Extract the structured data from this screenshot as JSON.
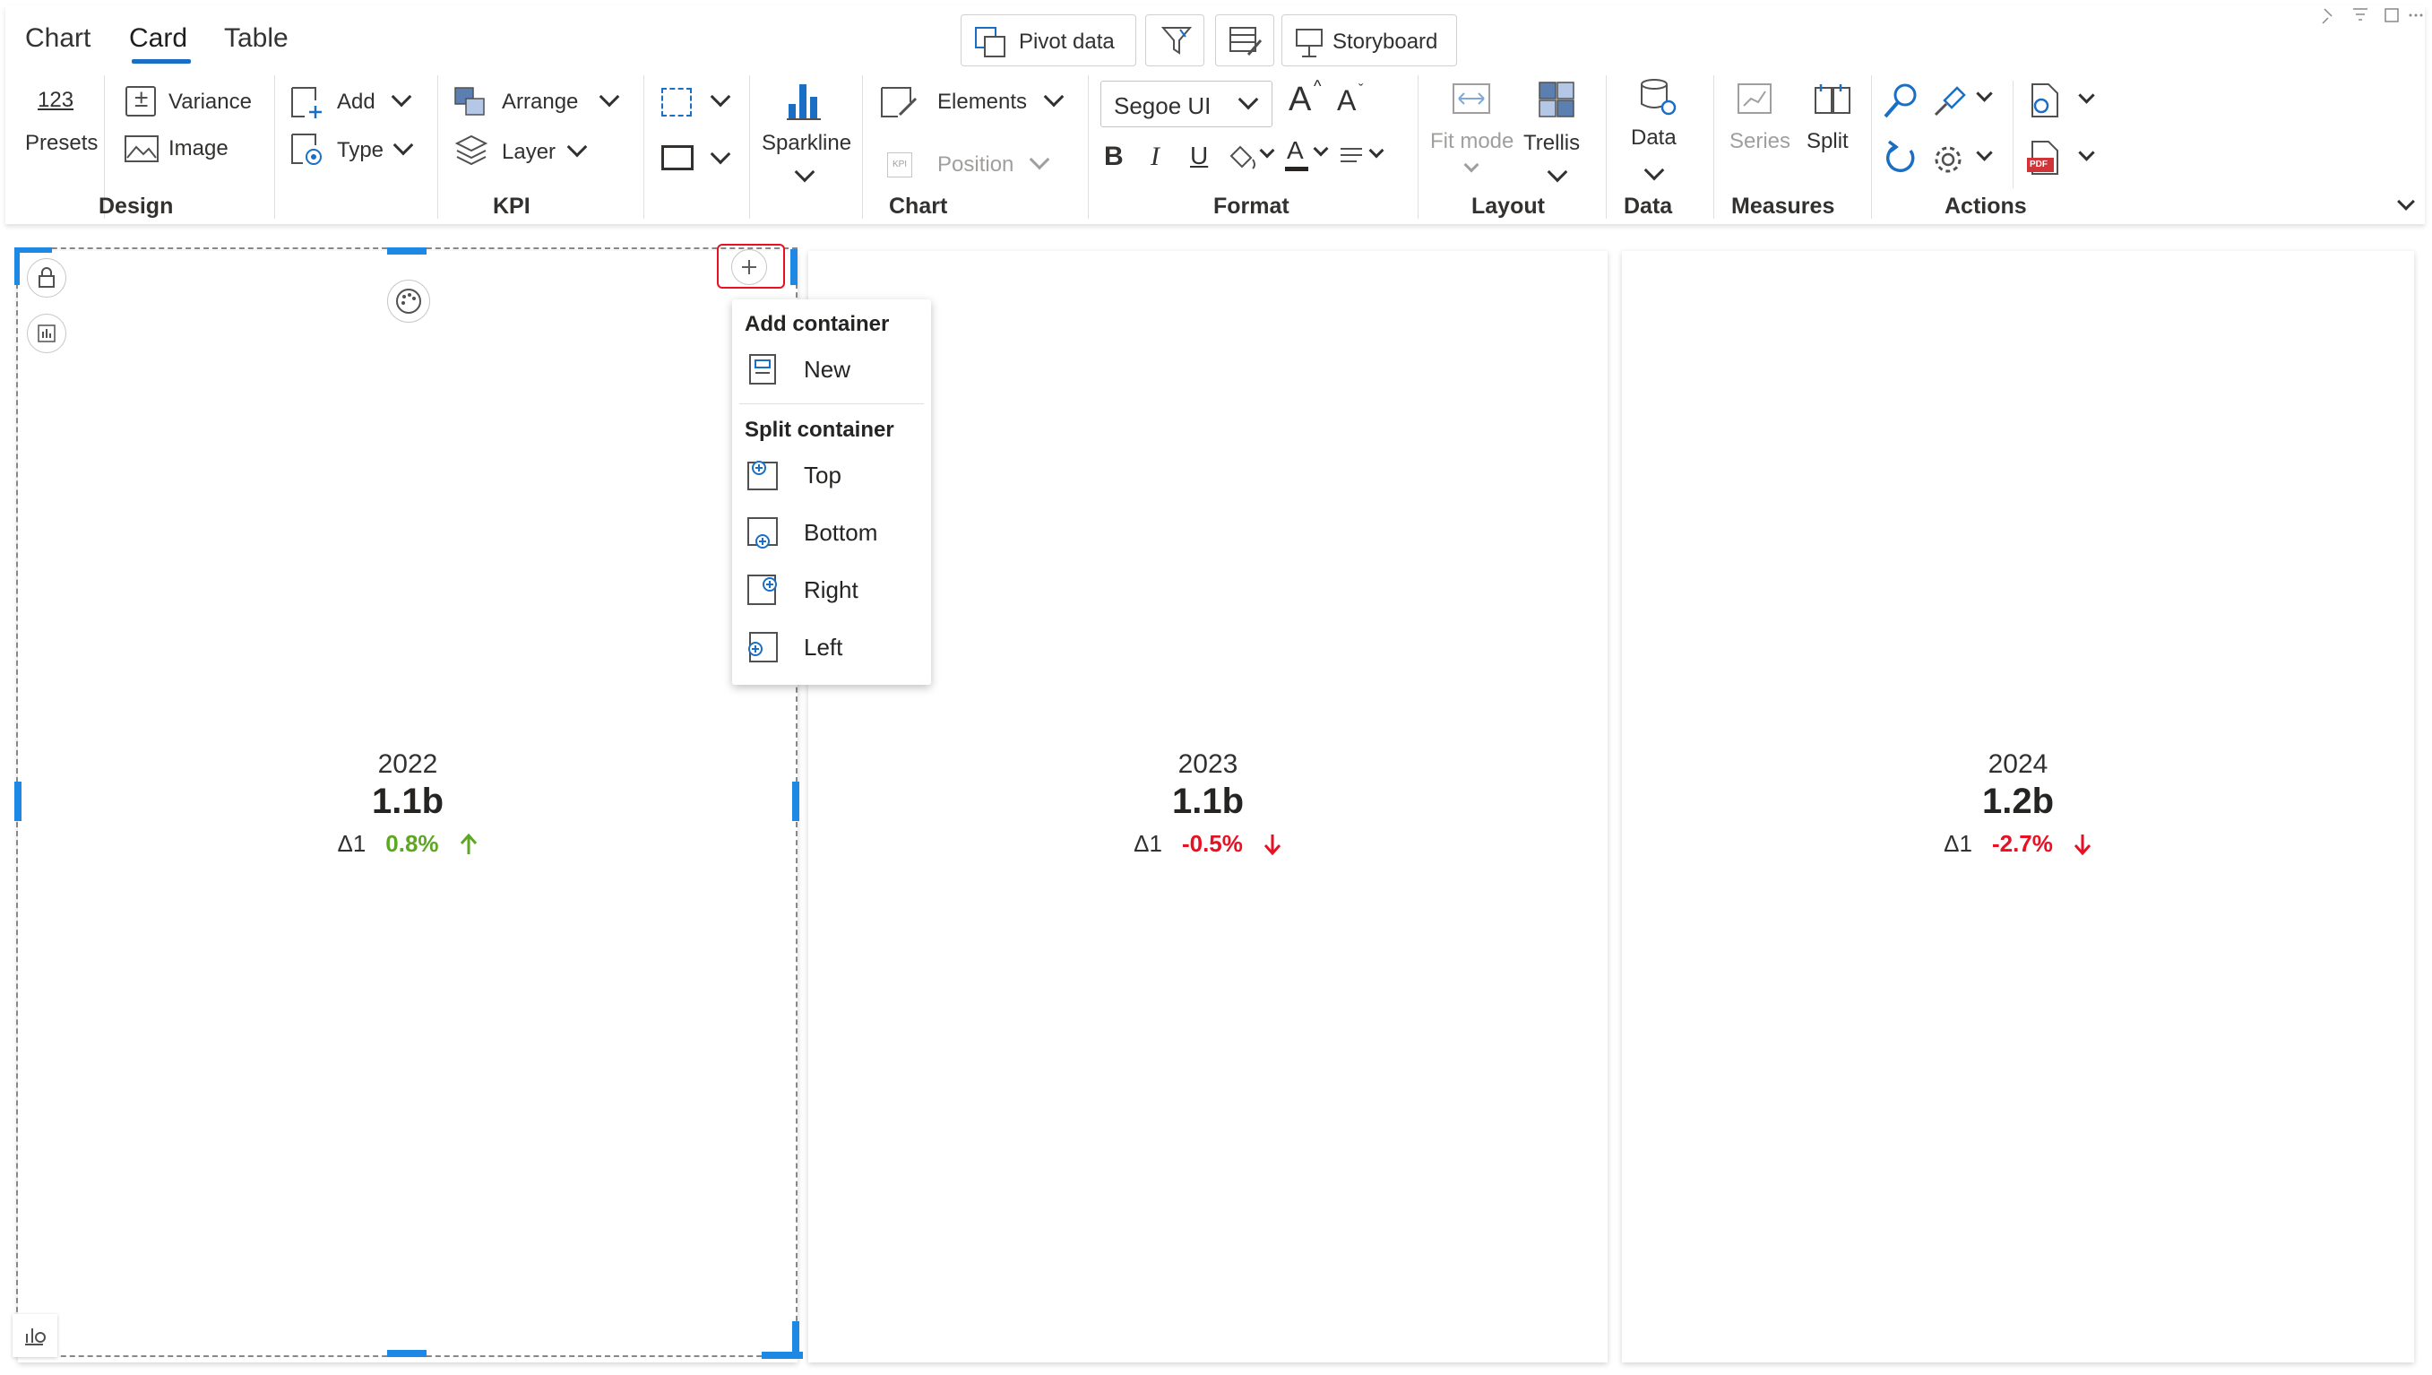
{
  "tabs": [
    {
      "label": "Chart",
      "active": false
    },
    {
      "label": "Card",
      "active": true
    },
    {
      "label": "Table",
      "active": false
    }
  ],
  "top_buttons": {
    "pivot": "Pivot data",
    "storyboard": "Storyboard"
  },
  "design": {
    "presets_number": "123",
    "presets": "Presets",
    "variance": "Variance",
    "image": "Image",
    "title": "Design"
  },
  "kpi": {
    "add": "Add",
    "type": "Type",
    "arrange": "Arrange",
    "layer": "Layer",
    "sparkline": "Sparkline",
    "title": "KPI"
  },
  "chart_group": {
    "elements": "Elements",
    "position": "Position",
    "kpi_badge": "KPI",
    "title": "Chart"
  },
  "format": {
    "font": "Segoe UI",
    "bold": "B",
    "italic": "I",
    "underline": "U",
    "color_letter": "A",
    "grow": "A",
    "shrink": "A",
    "title": "Format"
  },
  "layout": {
    "fit_mode": "Fit mode",
    "trellis": "Trellis",
    "title": "Layout"
  },
  "data_group": {
    "data": "Data",
    "title": "Data"
  },
  "measures": {
    "series": "Series",
    "split": "Split",
    "title": "Measures"
  },
  "actions": {
    "title": "Actions",
    "pdf": "PDF"
  },
  "cards": [
    {
      "year": "2022",
      "value": "1.1b",
      "delta_label": "Δ1",
      "delta": "0.8%",
      "direction": "up"
    },
    {
      "year": "2023",
      "value": "1.1b",
      "delta_label": "Δ1",
      "delta": "-0.5%",
      "direction": "down"
    },
    {
      "year": "2024",
      "value": "1.2b",
      "delta_label": "Δ1",
      "delta": "-2.7%",
      "direction": "down"
    }
  ],
  "menu": {
    "add_header": "Add container",
    "new": "New",
    "split_header": "Split container",
    "top": "Top",
    "bottom": "Bottom",
    "right": "Right",
    "left": "Left"
  },
  "colors": {
    "accent": "#1a6fc4",
    "handle": "#1e88e5",
    "positive": "#5ea722",
    "negative": "#e81123",
    "highlight": "#e81123"
  }
}
